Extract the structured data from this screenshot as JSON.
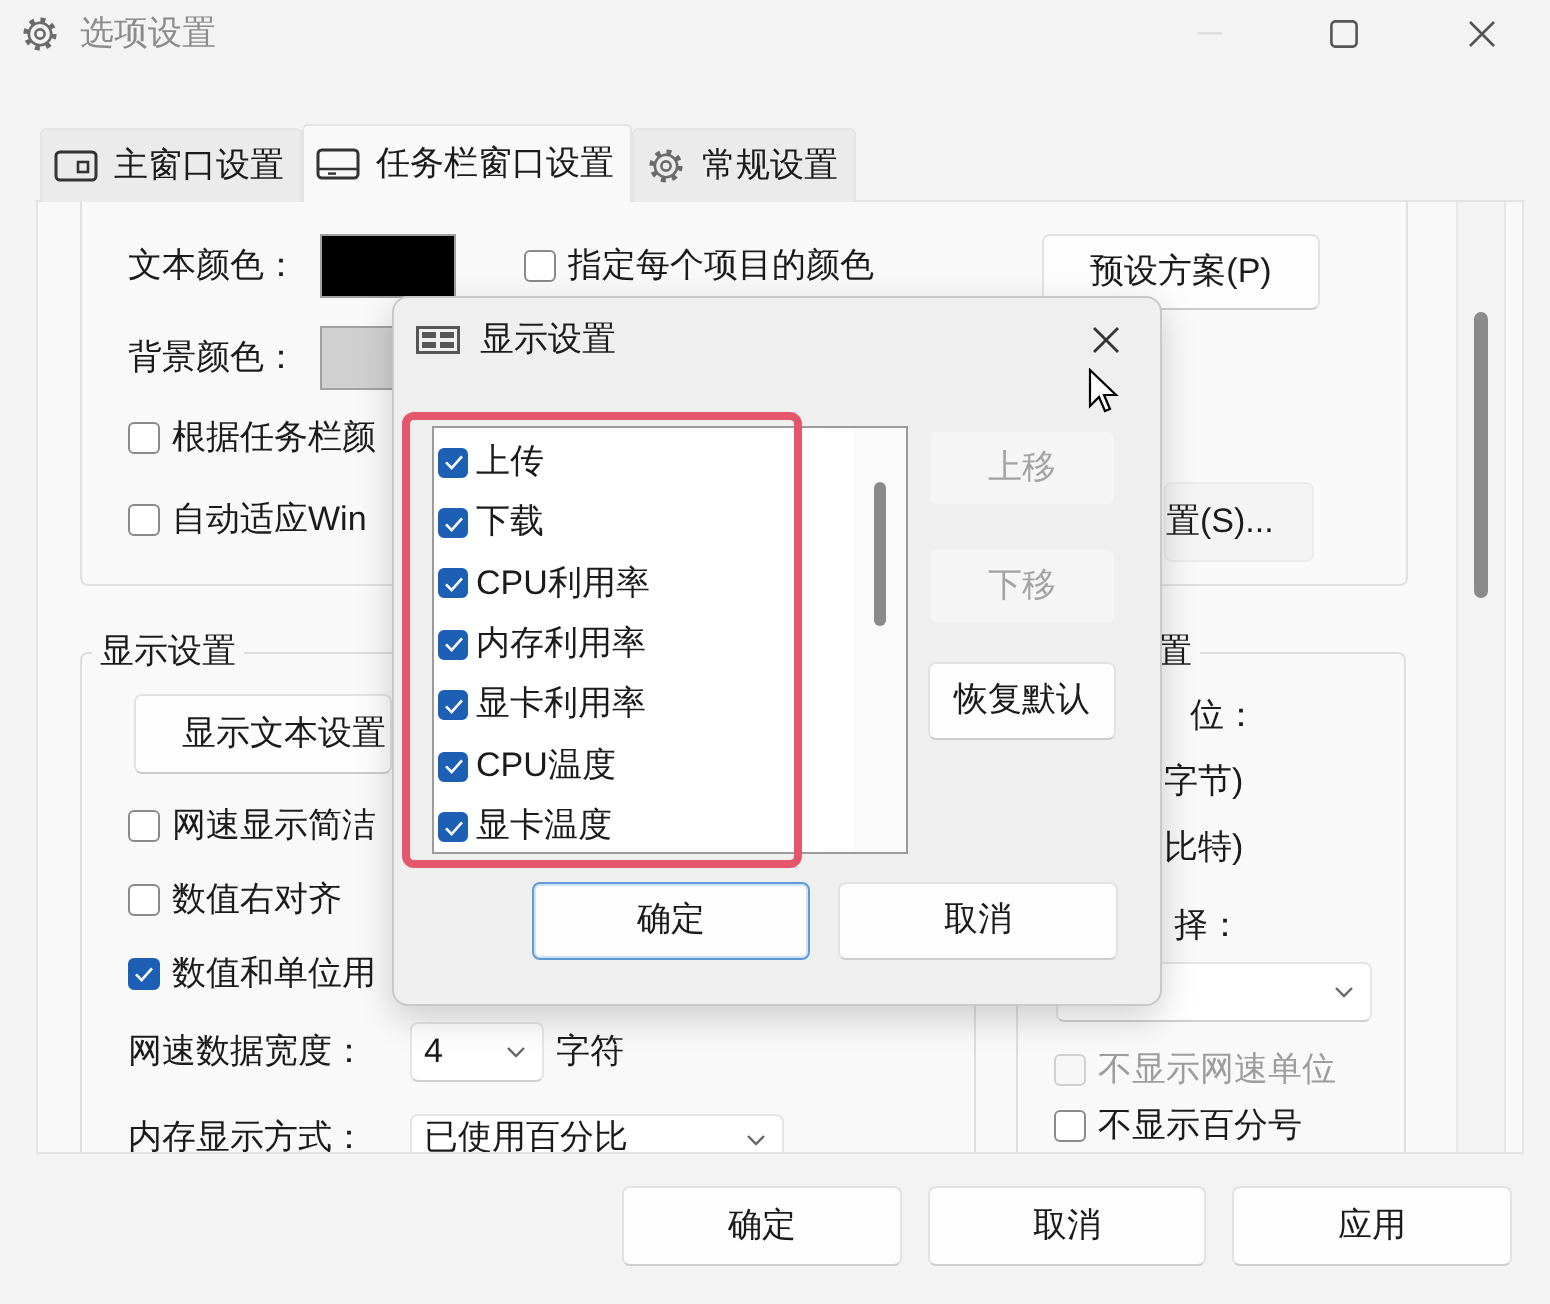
{
  "window": {
    "title": "选项设置"
  },
  "tabs": [
    {
      "label": "主窗口设置",
      "selected": false,
      "kind": "window"
    },
    {
      "label": "任务栏窗口设置",
      "selected": true,
      "kind": "taskbar"
    },
    {
      "label": "常规设置",
      "selected": false,
      "kind": "gear"
    }
  ],
  "color_settings": {
    "rows": [
      {
        "label": "文本颜色：",
        "color": "#000000"
      },
      {
        "label": "背景颜色：",
        "color": "#d0d0d0"
      }
    ],
    "per_item_color": {
      "label": "指定每个项目的颜色",
      "checked": false
    },
    "checkboxes": [
      {
        "label": "根据任务栏颜",
        "checked": false
      },
      {
        "label": "自动适应Win",
        "checked": false
      }
    ],
    "preset_button": "预设方案(P)",
    "settings_button": "置(S)..."
  },
  "display_settings": {
    "title": "显示设置",
    "text_settings_button": "显示文本设置",
    "checkboxes": [
      {
        "label": "网速显示简洁",
        "checked": false
      },
      {
        "label": "数值右对齐",
        "checked": false
      },
      {
        "label": "数值和单位用",
        "checked": true
      }
    ],
    "fields": [
      {
        "label": "网速数据宽度：",
        "value": "4",
        "unit": "字符"
      },
      {
        "label": "内存显示方式：",
        "value": "已使用百分比"
      }
    ]
  },
  "unit_settings": {
    "title": "置",
    "unit_label": "位：",
    "options": [
      "字节)",
      "比特)"
    ],
    "select_label": "择：",
    "checkboxes": [
      {
        "label": "不显示网速单位",
        "checked": false,
        "disabled": true
      },
      {
        "label": "不显示百分号",
        "checked": false,
        "disabled": false
      }
    ]
  },
  "buttons": [
    "确定",
    "取消",
    "应用"
  ],
  "dialog": {
    "title": "显示设置",
    "items": [
      {
        "label": "上传",
        "checked": true
      },
      {
        "label": "下载",
        "checked": true
      },
      {
        "label": "CPU利用率",
        "checked": true
      },
      {
        "label": "内存利用率",
        "checked": true
      },
      {
        "label": "显卡利用率",
        "checked": true
      },
      {
        "label": "CPU温度",
        "checked": true
      },
      {
        "label": "显卡温度",
        "checked": true
      }
    ],
    "side_buttons": [
      {
        "label": "上移",
        "disabled": true
      },
      {
        "label": "下移",
        "disabled": true
      },
      {
        "label": "恢复默认",
        "disabled": false
      }
    ],
    "buttons": [
      {
        "label": "确定",
        "focused": true
      },
      {
        "label": "取消",
        "focused": false
      }
    ]
  }
}
